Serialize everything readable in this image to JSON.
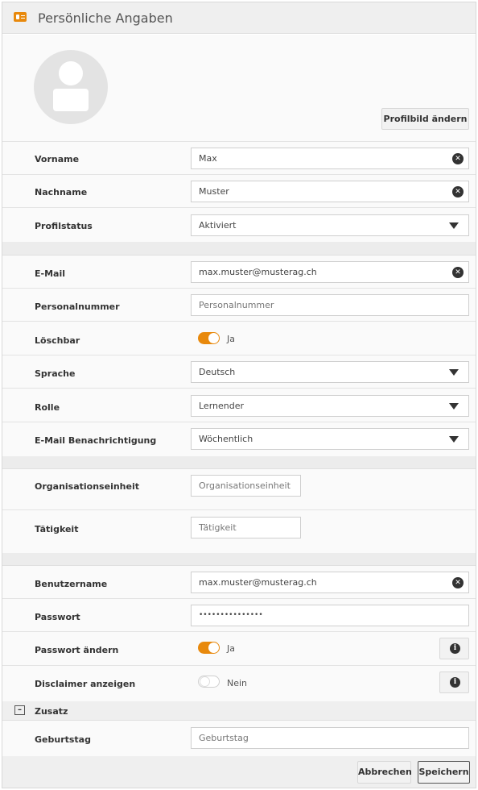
{
  "header": {
    "title": "Persönliche Angaben",
    "icon": "contact-card-icon"
  },
  "profile": {
    "change_picture_label": "Profilbild ändern",
    "avatar_icon": "user-avatar-icon"
  },
  "fields": {
    "vorname": {
      "label": "Vorname",
      "value": "Max"
    },
    "nachname": {
      "label": "Nachname",
      "value": "Muster"
    },
    "profilstatus": {
      "label": "Profilstatus",
      "value": "Aktiviert"
    },
    "email": {
      "label": "E-Mail",
      "value": "max.muster@musterag.ch"
    },
    "personalnummer": {
      "label": "Personalnummer",
      "placeholder": "Personalnummer"
    },
    "loeschbar": {
      "label": "Löschbar",
      "state": "Ja",
      "checked": true
    },
    "sprache": {
      "label": "Sprache",
      "value": "Deutsch"
    },
    "rolle": {
      "label": "Rolle",
      "value": "Lernender"
    },
    "email_benachrichtigung": {
      "label": "E-Mail Benachrichtigung",
      "value": "Wöchentlich"
    },
    "organisationseinheit": {
      "label": "Organisationseinheit",
      "placeholder": "Organisationseinheit"
    },
    "taetigkeit": {
      "label": "Tätigkeit",
      "placeholder": "Tätigkeit"
    },
    "benutzername": {
      "label": "Benutzername",
      "value": "max.muster@musterag.ch"
    },
    "passwort": {
      "label": "Passwort",
      "value": "•••••••••••••••"
    },
    "passwort_aendern": {
      "label": "Passwort ändern",
      "state": "Ja",
      "checked": true
    },
    "disclaimer": {
      "label": "Disclaimer anzeigen",
      "state": "Nein",
      "checked": false
    },
    "geburtstag": {
      "label": "Geburtstag",
      "placeholder": "Geburtstag"
    }
  },
  "zusatz": {
    "label": "Zusatz",
    "icon": "collapse-icon"
  },
  "footer": {
    "cancel_label": "Abbrechen",
    "save_label": "Speichern"
  },
  "colors": {
    "accent": "#e8890c",
    "background": "#fafafa",
    "separator": "#ececec"
  }
}
